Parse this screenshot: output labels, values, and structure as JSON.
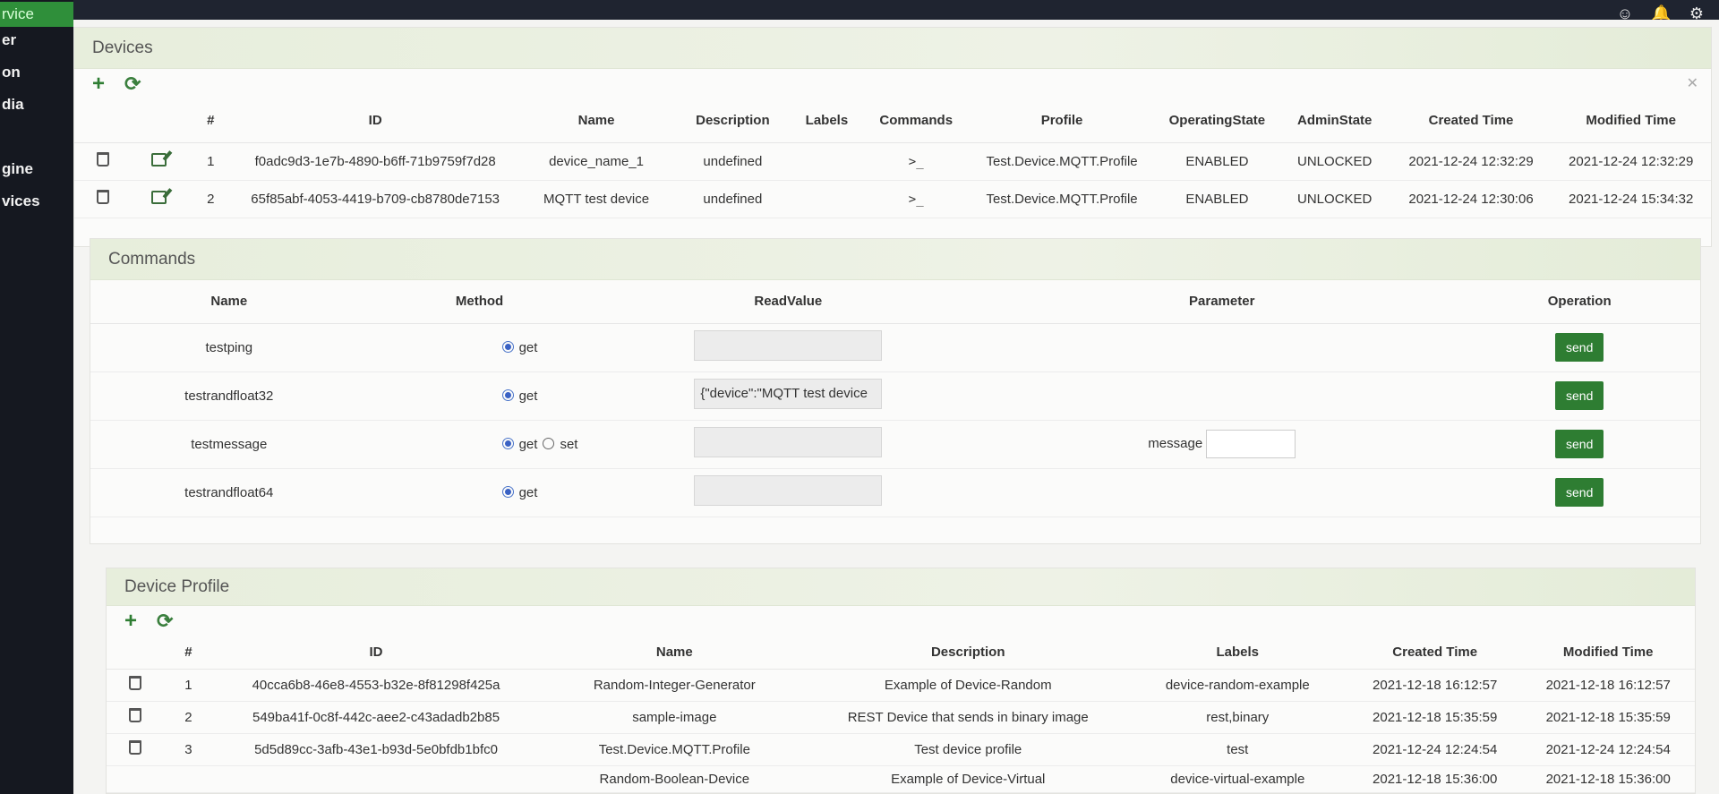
{
  "sidebar": {
    "items": [
      "rvice",
      "er",
      "on",
      "dia",
      "gine",
      "vices"
    ]
  },
  "devices": {
    "title": "Devices",
    "columns": [
      "#",
      "ID",
      "Name",
      "Description",
      "Labels",
      "Commands",
      "Profile",
      "OperatingState",
      "AdminState",
      "Created Time",
      "Modified Time"
    ],
    "rows": [
      {
        "num": "1",
        "id": "f0adc9d3-1e7b-4890-b6ff-71b9759f7d28",
        "name": "device_name_1",
        "description": "undefined",
        "labels": "",
        "commands": ">_",
        "profile": "Test.Device.MQTT.Profile",
        "operating": "ENABLED",
        "admin": "UNLOCKED",
        "created": "2021-12-24 12:32:29",
        "modified": "2021-12-24 12:32:29"
      },
      {
        "num": "2",
        "id": "65f85abf-4053-4419-b709-cb8780de7153",
        "name": "MQTT test device",
        "description": "undefined",
        "labels": "",
        "commands": ">_",
        "profile": "Test.Device.MQTT.Profile",
        "operating": "ENABLED",
        "admin": "UNLOCKED",
        "created": "2021-12-24 12:30:06",
        "modified": "2021-12-24 15:34:32"
      }
    ]
  },
  "commands": {
    "title": "Commands",
    "columns": [
      "Name",
      "Method",
      "ReadValue",
      "Parameter",
      "Operation"
    ],
    "rows": [
      {
        "name": "testping",
        "method_get": "get",
        "read_value": "",
        "send": "send"
      },
      {
        "name": "testrandfloat32",
        "method_get": "get",
        "read_value": "{\"device\":\"MQTT test device",
        "send": "send"
      },
      {
        "name": "testmessage",
        "method_get": "get",
        "method_set": "set",
        "read_value": "",
        "param_label": "message",
        "send": "send"
      },
      {
        "name": "testrandfloat64",
        "method_get": "get",
        "read_value": "",
        "send": "send"
      }
    ]
  },
  "profiles": {
    "title": "Device Profile",
    "columns": [
      "#",
      "ID",
      "Name",
      "Description",
      "Labels",
      "Created Time",
      "Modified Time"
    ],
    "rows": [
      {
        "num": "1",
        "id": "40cca6b8-46e8-4553-b32e-8f81298f425a",
        "name": "Random-Integer-Generator",
        "description": "Example of Device-Random",
        "labels": "device-random-example",
        "created": "2021-12-18 16:12:57",
        "modified": "2021-12-18 16:12:57"
      },
      {
        "num": "2",
        "id": "549ba41f-0c8f-442c-aee2-c43adadb2b85",
        "name": "sample-image",
        "description": "REST Device that sends in binary image",
        "labels": "rest,binary",
        "created": "2021-12-18 15:35:59",
        "modified": "2021-12-18 15:35:59"
      },
      {
        "num": "3",
        "id": "5d5d89cc-3afb-43e1-b93d-5e0bfdb1bfc0",
        "name": "Test.Device.MQTT.Profile",
        "description": "Test device profile",
        "labels": "test",
        "created": "2021-12-24 12:24:54",
        "modified": "2021-12-24 12:24:54"
      },
      {
        "num": "",
        "id": "",
        "name": "Random-Boolean-Device",
        "description": "Example of Device-Virtual",
        "labels": "device-virtual-example",
        "created": "2021-12-18 15:36:00",
        "modified": "2021-12-18 15:36:00"
      }
    ]
  },
  "icons": {
    "add": "plus-icon",
    "refresh": "refresh-icon",
    "delete": "trash-icon",
    "edit": "edit-icon",
    "command": "terminal-icon"
  },
  "colors": {
    "accent": "#2e7d32",
    "sidebar_active": "#2f8f3a"
  }
}
